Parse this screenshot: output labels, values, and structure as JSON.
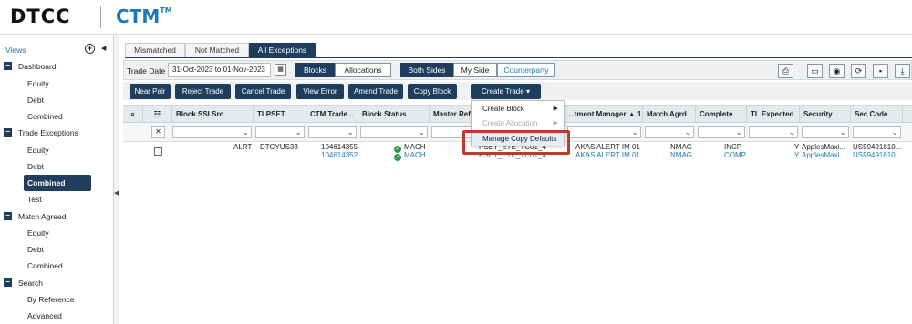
{
  "header": {
    "brand": "DTCC",
    "product": "CTM",
    "product_tm": "TM"
  },
  "sidebar": {
    "views_label": "Views",
    "groups": [
      {
        "label": "Dashboard",
        "items": [
          "Equity",
          "Debt",
          "Combined"
        ]
      },
      {
        "label": "Trade Exceptions",
        "items": [
          "Equity",
          "Debt",
          "Combined",
          "Test"
        ]
      },
      {
        "label": "Match Agreed",
        "items": [
          "Equity",
          "Debt",
          "Combined"
        ]
      },
      {
        "label": "Search",
        "items": [
          "By Reference",
          "Advanced"
        ]
      }
    ],
    "active_item": "Trade Exceptions > Combined"
  },
  "tabs": [
    "Mismatched",
    "Not Matched",
    "All Exceptions"
  ],
  "active_tab": "All Exceptions",
  "filter": {
    "trade_date_label": "Trade Date",
    "trade_date_value": "31-Oct-2023 to 01-Nov-2023",
    "view_toggle": [
      "Blocks",
      "Allocations"
    ],
    "view_selected": "Blocks",
    "side_toggle": [
      "Both Sides",
      "My Side",
      "Counterparty"
    ],
    "side_selected": "Both Sides",
    "tool_icons": [
      "pdf-icon",
      "panel-icon",
      "eye-icon",
      "refresh-icon",
      "save-icon",
      "download-icon"
    ]
  },
  "actions": [
    "Near Pair",
    "Reject Trade",
    "Cancel Trade",
    "View Error",
    "Amend Trade",
    "Copy Block",
    "Create Trade"
  ],
  "columns": [
    "Block SSI Src",
    "TLPSET",
    "CTM Trade...",
    "Block Status",
    "Master Ref",
    "...tment Manager ▲ 1",
    "Match Agrd",
    "Complete",
    "TL Expected",
    "Security",
    "Sec Code"
  ],
  "row": {
    "ssi_src": "ALRT",
    "tlpset": "DTCYUS33",
    "ctm_trade_1": "104614355",
    "ctm_trade_2": "104614352",
    "status_1": "MACH",
    "status_2": "MACH",
    "master_ref_1": "PSET_ETE_TC01_4",
    "master_ref_2": "PSET_ETE_TC01_4",
    "inv_mgr_1": "AKAS ALERT IM 01",
    "inv_mgr_2": "AKAS ALERT IM 01",
    "match_1": "NMAG",
    "match_2": "NMAG",
    "complete_1": "INCP",
    "complete_2": "COMP",
    "tl_1": "Y",
    "tl_2": "Y",
    "security_1": "ApplesMaxi...",
    "security_2": "ApplesMaxi...",
    "sec_code_1": "US59491810...",
    "sec_code_2": "US59491810..."
  },
  "dropdown": {
    "items": [
      "Create Block",
      "Create Allocation",
      "Manage Copy Defaults"
    ],
    "disabled": [
      "Create Allocation"
    ],
    "highlighted": "Manage Copy Defaults"
  },
  "colors": {
    "navy": "#1f3d5c",
    "link_blue": "#1c7ab8",
    "highlight_red": "#c0392b",
    "ok_green": "#2e9a44"
  }
}
